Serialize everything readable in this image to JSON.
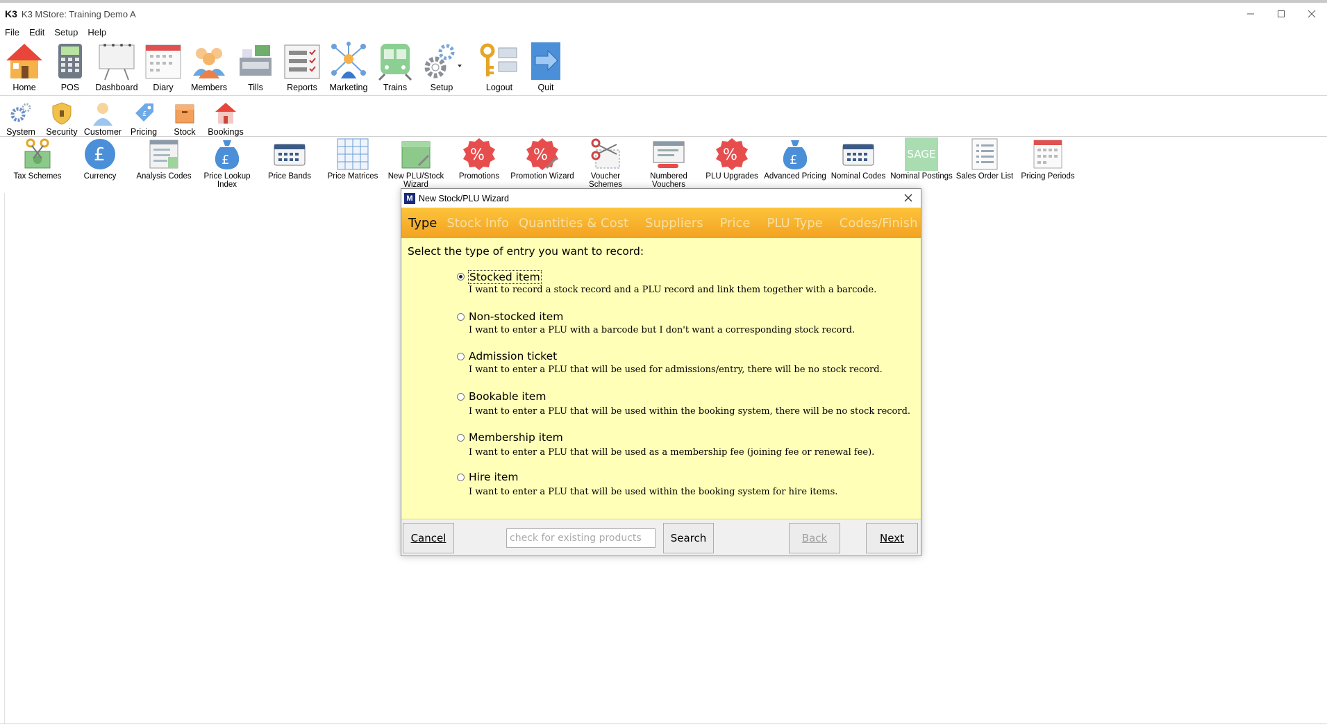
{
  "window": {
    "logo": "K3",
    "title": "K3 MStore: Training Demo A"
  },
  "menu": [
    "File",
    "Edit",
    "Setup",
    "Help"
  ],
  "toolbar": [
    "Home",
    "POS",
    "Dashboard",
    "Diary",
    "Members",
    "Tills",
    "Reports",
    "Marketing",
    "Trains",
    "Setup",
    "Logout",
    "Quit"
  ],
  "subtoolbar": [
    "System",
    "Security",
    "Customer",
    "Pricing",
    "Stock",
    "Bookings"
  ],
  "pricing_tools": [
    {
      "label": "Tax Schemes"
    },
    {
      "label": "Currency"
    },
    {
      "label": "Analysis Codes"
    },
    {
      "label": "Price Lookup Index"
    },
    {
      "label": "Price Bands"
    },
    {
      "label": "Price Matrices"
    },
    {
      "label": "New PLU/Stock Wizard"
    },
    {
      "label": "Promotions"
    },
    {
      "label": "Promotion Wizard"
    },
    {
      "label": "Voucher Schemes"
    },
    {
      "label": "Numbered Vouchers"
    },
    {
      "label": "PLU Upgrades"
    },
    {
      "label": "Advanced Pricing"
    },
    {
      "label": "Nominal Codes"
    },
    {
      "label": "Nominal Postings"
    },
    {
      "label": "Sales Order List"
    },
    {
      "label": "Pricing Periods"
    }
  ],
  "sage_label": "SAGE",
  "dialog": {
    "logo": "M",
    "title": "New Stock/PLU Wizard",
    "steps": [
      "Type",
      "Stock Info",
      "Quantities & Cost",
      "Suppliers",
      "Price",
      "PLU Type",
      "Codes/Finish"
    ],
    "prompt": "Select the type of entry you want to record:",
    "options": [
      {
        "title": "Stocked item",
        "desc": "I want to record a stock record and a PLU record and link them together with a barcode.",
        "selected": true
      },
      {
        "title": "Non-stocked item",
        "desc": "I want to enter a PLU with a barcode but I don't want a corresponding stock record.",
        "selected": false
      },
      {
        "title": "Admission ticket",
        "desc": "I want to enter a PLU that will be used for admissions/entry, there will be no stock record.",
        "selected": false
      },
      {
        "title": "Bookable item",
        "desc": "I want to enter a PLU that will be used within the booking system, there will be no stock record.",
        "selected": false
      },
      {
        "title": "Membership item",
        "desc": "I want to enter a PLU that will be used as a membership fee (joining fee or renewal fee).",
        "selected": false
      },
      {
        "title": "Hire item",
        "desc": "I want to enter a PLU that will be used within the booking system for hire items.",
        "selected": false
      }
    ],
    "buttons": {
      "cancel": "Cancel",
      "search": "Search",
      "back": "Back",
      "next": "Next"
    },
    "search_placeholder": "check for existing products"
  },
  "colors": {
    "wizard_bar_top": "#fdc43b",
    "wizard_bar_bottom": "#f3a221",
    "wizard_body": "#ffffb7",
    "pricing_icon_blue": "#4a8fd8",
    "promo_red": "#e84d4d"
  }
}
